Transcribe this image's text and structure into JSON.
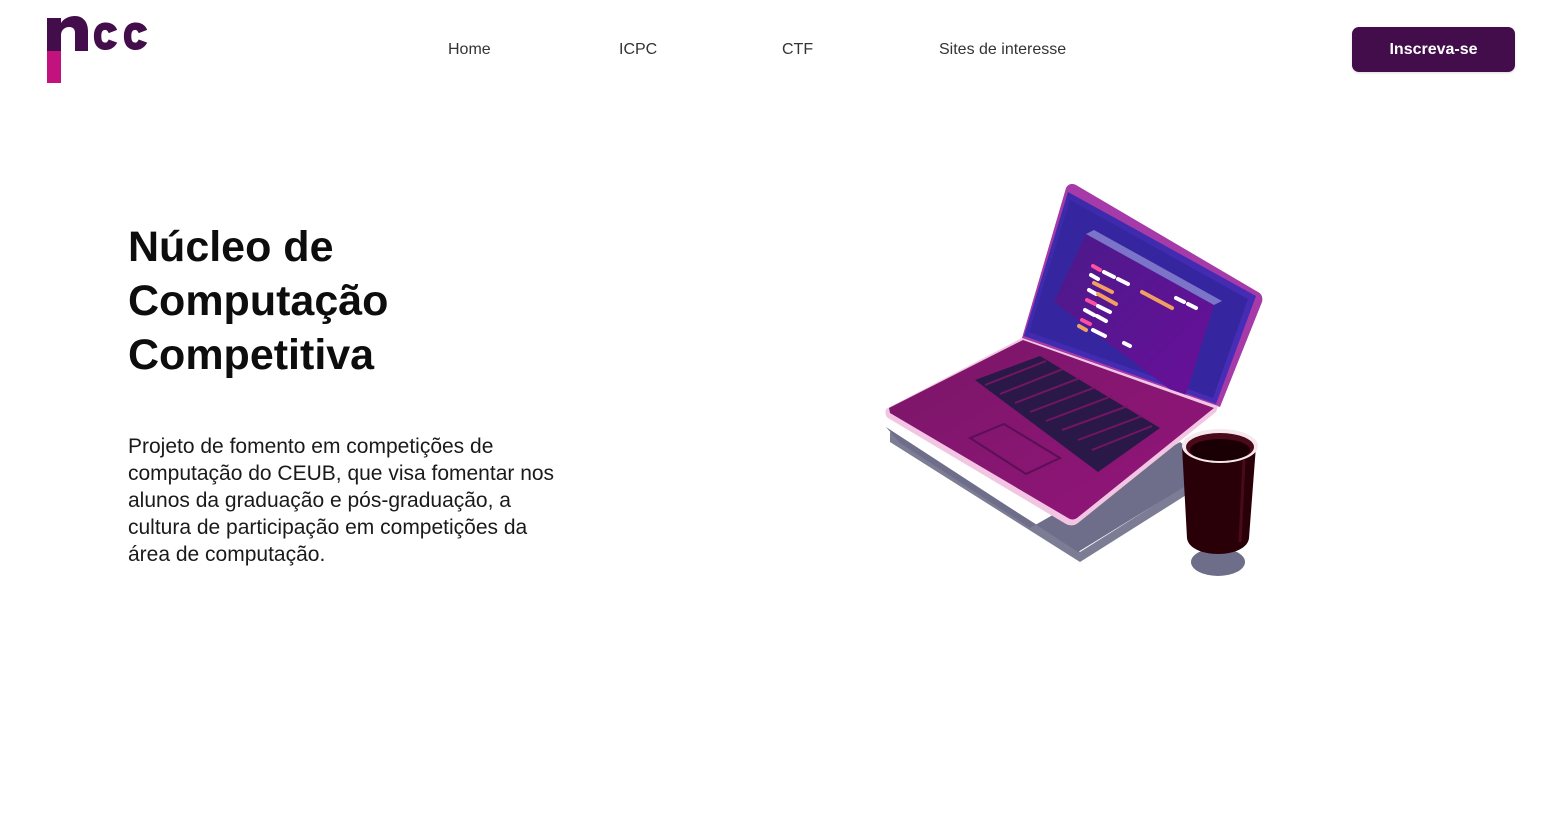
{
  "logo": {
    "text": "ncc",
    "colors": {
      "primary": "#430d4b",
      "accent": "#c2127d"
    }
  },
  "nav": {
    "items": [
      {
        "label": "Home"
      },
      {
        "label": "ICPC"
      },
      {
        "label": "CTF"
      },
      {
        "label": "Sites de interesse"
      }
    ],
    "cta_label": "Inscreva-se"
  },
  "hero": {
    "title_lines": [
      "Núcleo de",
      "Computação",
      "Competitiva"
    ],
    "description": "Projeto de fomento em competições de computação do CEUB, que visa fomentar nos alunos da graduação e pós-graduação, a cultura de participação em competições da área de computação."
  },
  "illustration": {
    "icon": "laptop-with-coffee-cup",
    "colors": {
      "laptop_body": "#8a1570",
      "screen_frame": "#3a2aa8",
      "code_window": "#5a0f8a",
      "cup": "#2a0008",
      "shadow": "#6e6e8a"
    }
  },
  "theme": {
    "brand": "#430d4b",
    "background": "#ffffff"
  }
}
